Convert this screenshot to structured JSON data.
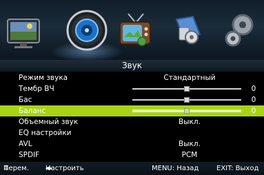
{
  "menu": {
    "title": "Звук"
  },
  "items": [
    {
      "label": "Режим звука",
      "value": "Стандартный",
      "kind": "text"
    },
    {
      "label": "Тембр ВЧ",
      "value": "0",
      "kind": "slider",
      "level": 0.5
    },
    {
      "label": "Бас",
      "value": "0",
      "kind": "slider",
      "level": 0.5
    },
    {
      "label": "Баланс",
      "value": "0",
      "kind": "slider",
      "level": 0.5,
      "selected": true
    },
    {
      "label": "Объемный звук",
      "value": "Выкл.",
      "kind": "text"
    },
    {
      "label": "EQ настройки",
      "value": "",
      "kind": "text"
    },
    {
      "label": "AVL",
      "value": "Выкл.",
      "kind": "text"
    },
    {
      "label": "SPDIF",
      "value": "PCM",
      "kind": "text"
    }
  ],
  "footer": {
    "move": "Перем.",
    "adjust": "Настроить",
    "back": "MENU: Назад",
    "exit": "EXIT: Выход"
  },
  "top_icons": [
    "picture-icon",
    "sound-icon",
    "channel-icon",
    "settings-icon",
    "setup-icon"
  ],
  "colors": {
    "highlight": "#a7d515",
    "background": "#000000",
    "bar": "#1b2c3a"
  }
}
